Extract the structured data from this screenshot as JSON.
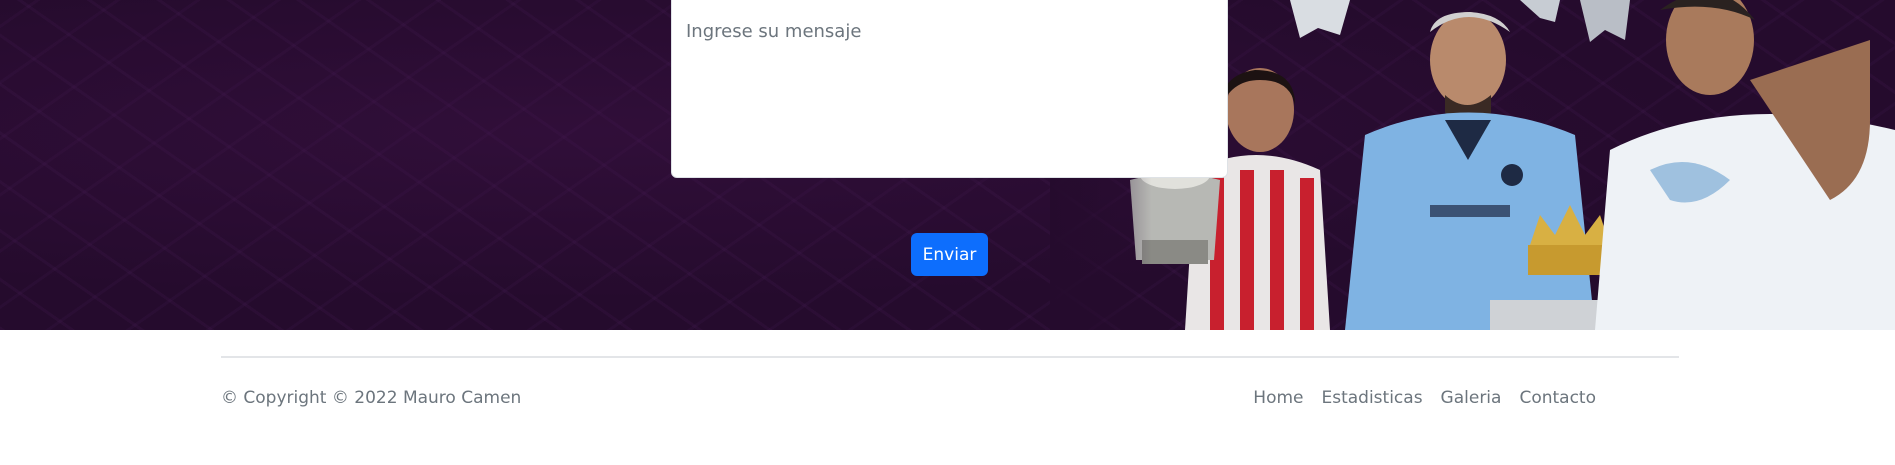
{
  "contact_form": {
    "message_placeholder": "Ingrese su mensaje",
    "submit_label": "Enviar"
  },
  "footer": {
    "copyright": "© Copyright © 2022 Mauro Camen",
    "nav": {
      "home": "Home",
      "stats": "Estadisticas",
      "gallery": "Galeria",
      "contact": "Contacto"
    }
  },
  "colors": {
    "hero_background": "#250b2d",
    "primary_button": "#0d6efd",
    "footer_text": "#6c757d"
  }
}
